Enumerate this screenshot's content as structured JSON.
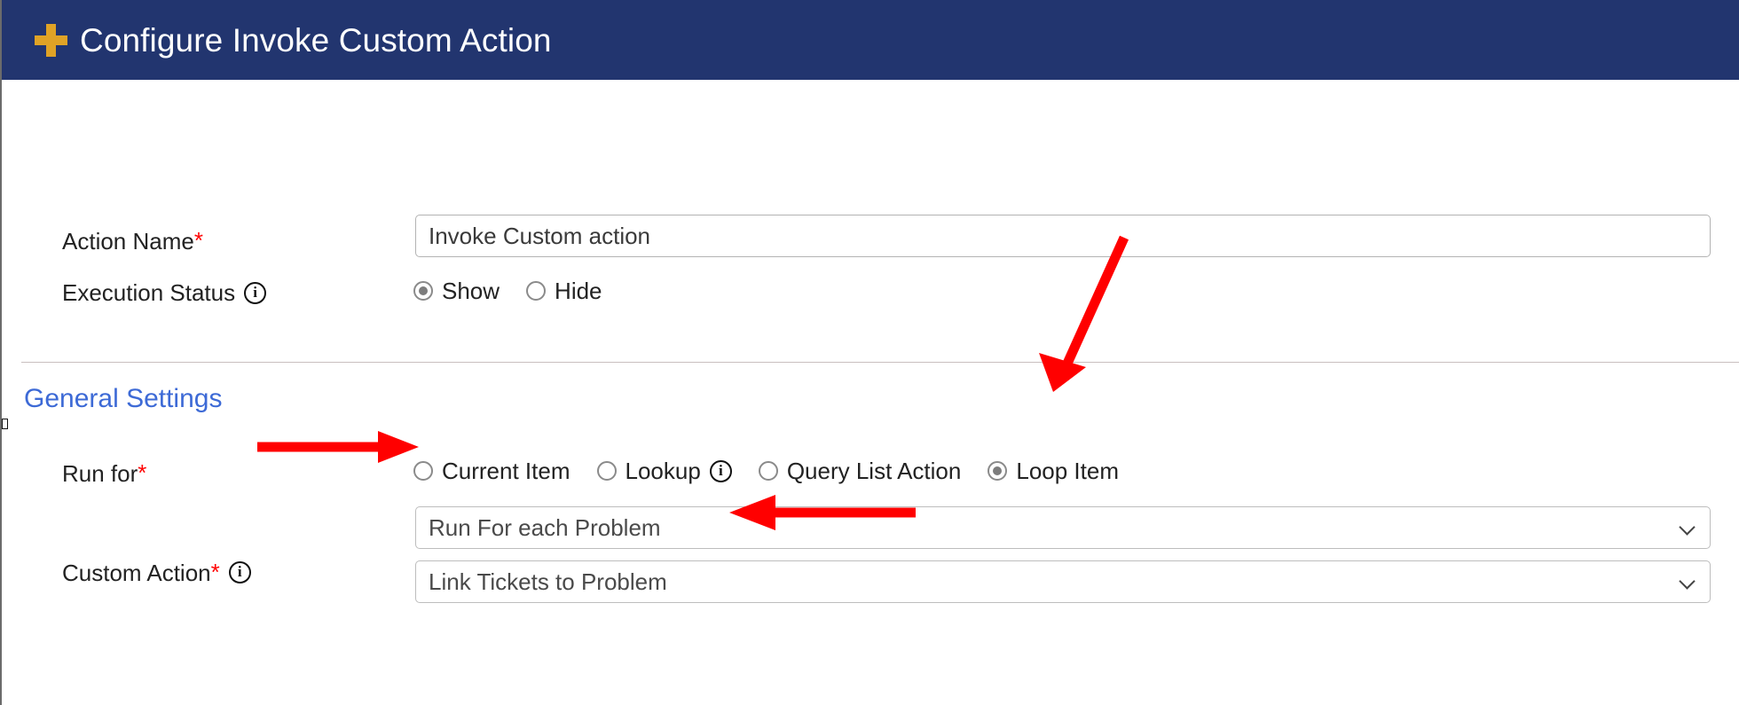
{
  "header": {
    "title": "Configure Invoke Custom Action",
    "plus_icon": "plus-icon",
    "bg_color": "#22356F",
    "icon_color": "#E0A326"
  },
  "form": {
    "action_name": {
      "label": "Action Name",
      "required_marker": "*",
      "value": "Invoke Custom action"
    },
    "execution_status": {
      "label": "Execution Status",
      "info_icon": "info-icon",
      "options": [
        {
          "label": "Show",
          "selected": true
        },
        {
          "label": "Hide",
          "selected": false
        }
      ]
    },
    "section": {
      "title": "General Settings",
      "title_color": "#3d6ad6"
    },
    "run_for": {
      "label": "Run for ",
      "required_marker": "*",
      "options": [
        {
          "label": "Current Item",
          "selected": false,
          "has_info": false
        },
        {
          "label": "Lookup",
          "selected": false,
          "has_info": true
        },
        {
          "label": "Query List Action",
          "selected": false,
          "has_info": false
        },
        {
          "label": "Loop Item",
          "selected": true,
          "has_info": false
        }
      ]
    },
    "loop_source": {
      "value": "Run For each Problem",
      "chevron": "chevron-down-icon"
    },
    "custom_action": {
      "label": "Custom Action",
      "required_marker": "*",
      "info_icon": "info-icon",
      "value": "Link Tickets to Problem",
      "chevron": "chevron-down-icon"
    }
  },
  "annotations": {
    "color": "#FF0000",
    "arrow_to_loop_item": "diagonal-arrow-pointing-to-loop-item-radio",
    "arrow_to_loop_source": "right-arrow-pointing-to-run-for-each-problem-dropdown",
    "arrow_to_custom_action": "left-arrow-pointing-to-link-tickets-to-problem-dropdown"
  }
}
